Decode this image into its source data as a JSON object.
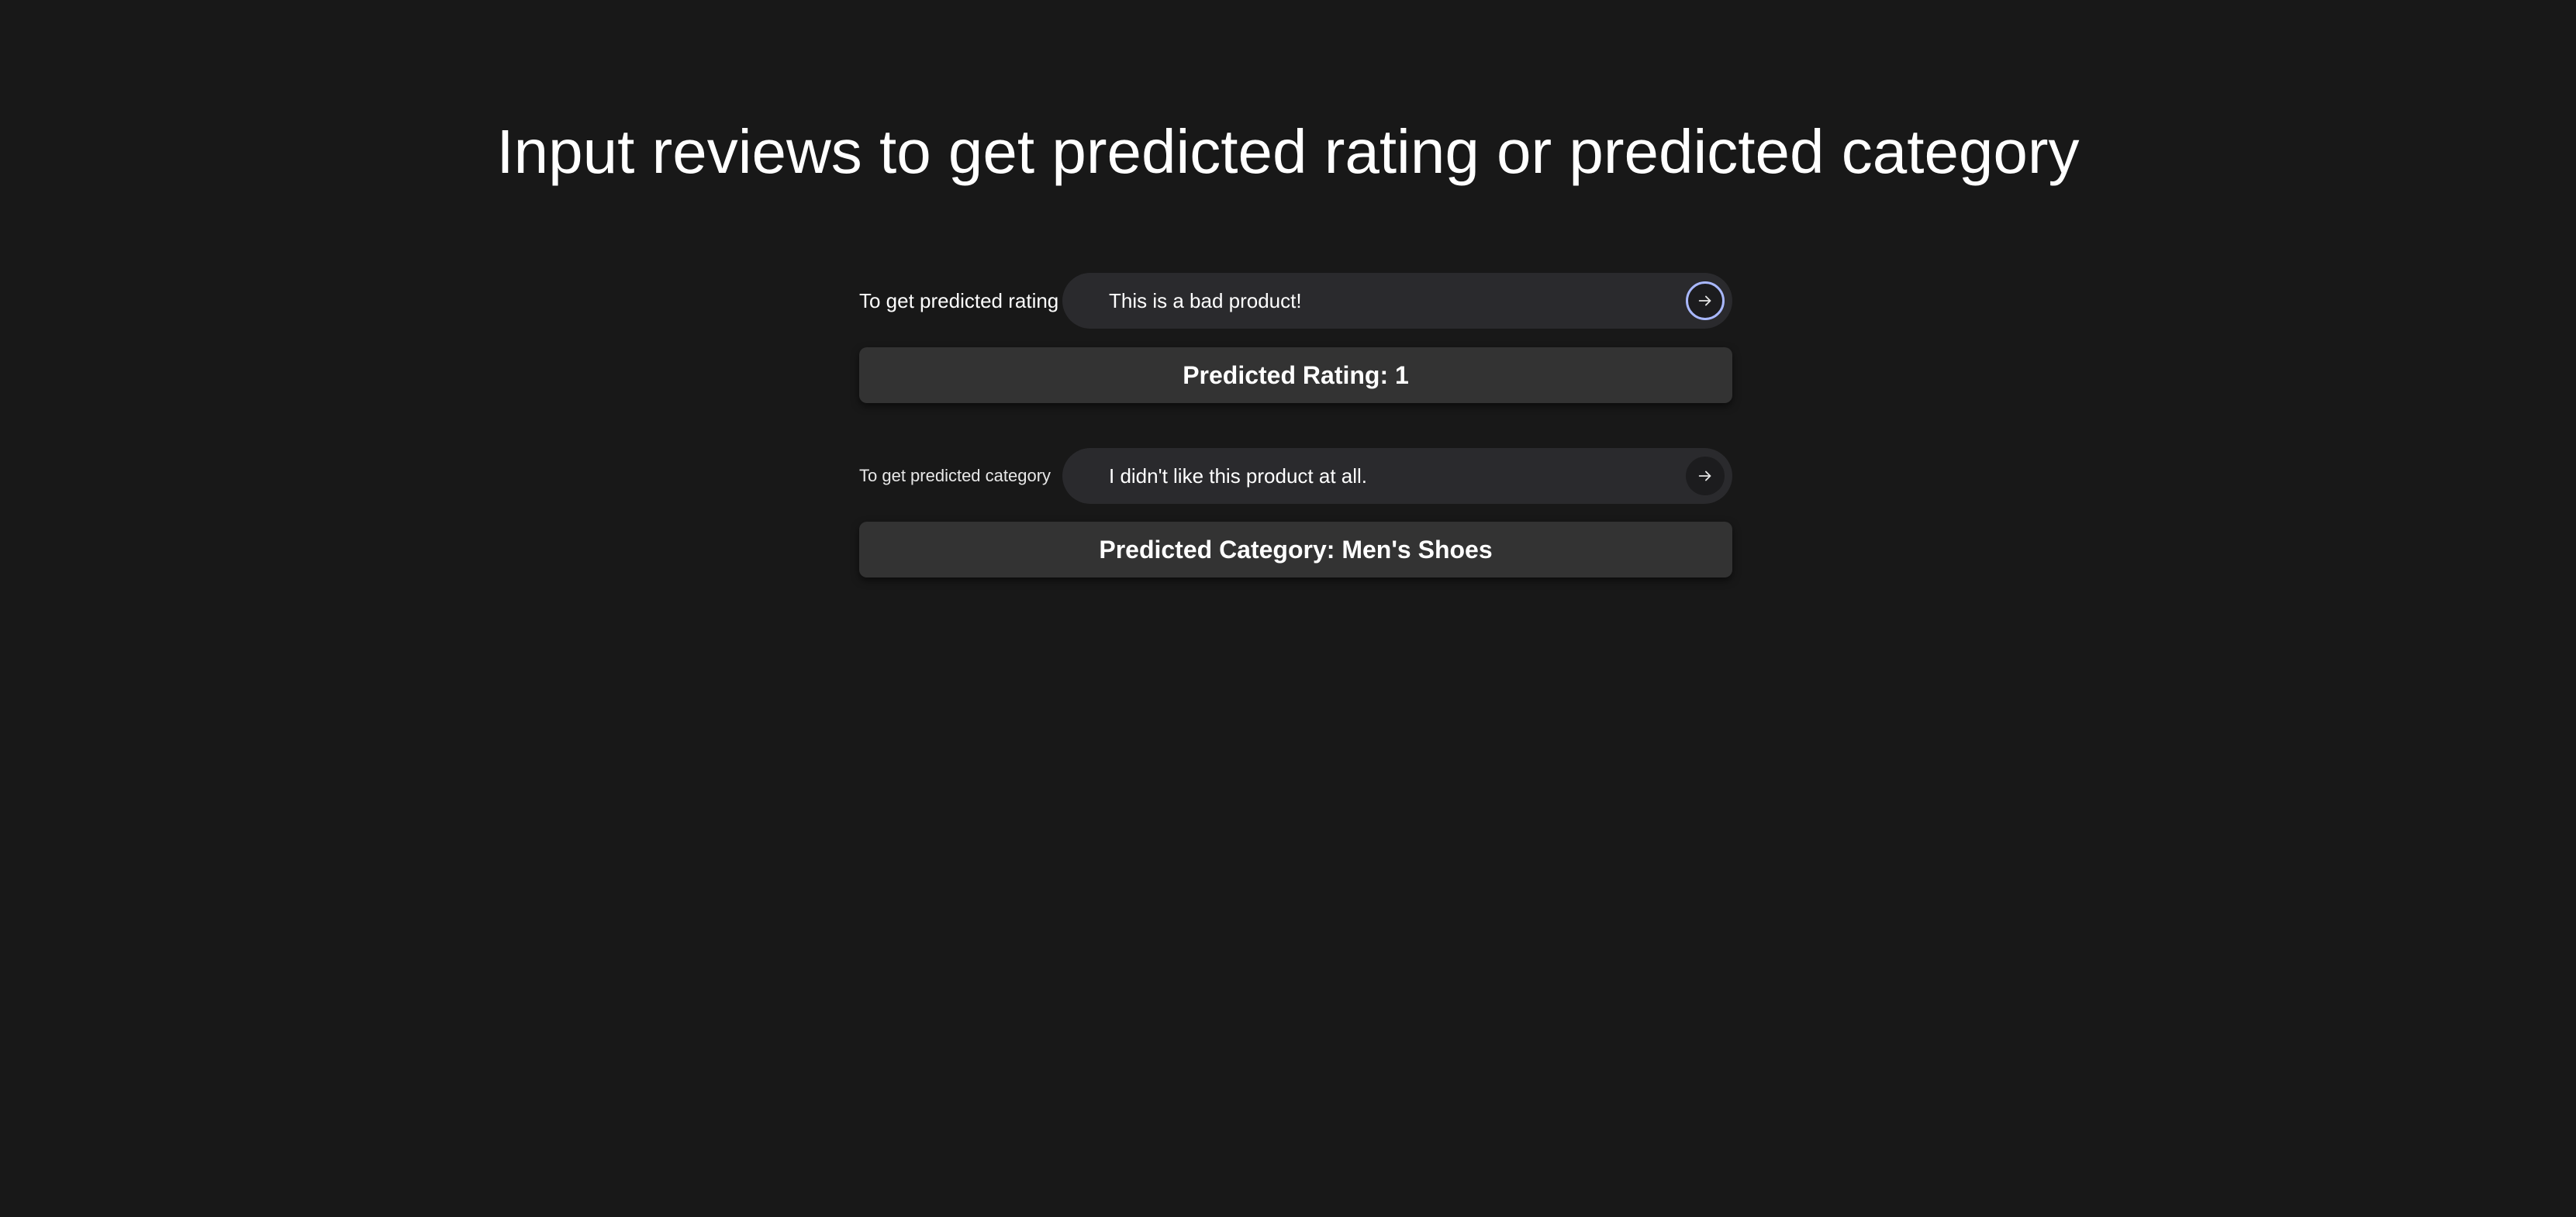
{
  "page": {
    "title": "Input reviews to get predicted rating or predicted category"
  },
  "rating_form": {
    "label": "To get predicted rating",
    "input_value": "This is a bad product!",
    "submit_icon": "arrow-right-icon",
    "result_text": "Predicted Rating: 1"
  },
  "category_form": {
    "label": "To get predicted category",
    "input_value": "I didn't like this product at all.",
    "submit_icon": "arrow-right-icon",
    "result_text": "Predicted Category: Men's Shoes"
  },
  "colors": {
    "background": "#181818",
    "input_background": "#2a2a2d",
    "result_background": "#333333",
    "focus_ring": "#a9b8ff"
  }
}
